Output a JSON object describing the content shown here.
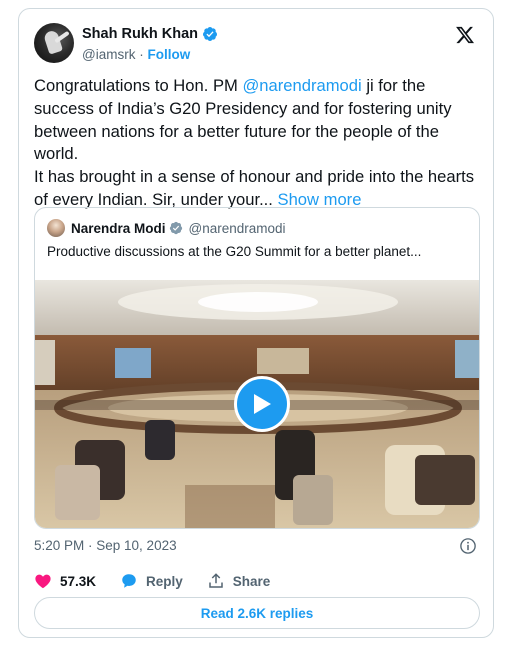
{
  "author": {
    "name": "Shah Rukh Khan",
    "handle": "@iamsrk",
    "separator": " · ",
    "follow_label": "Follow"
  },
  "tweet": {
    "text_part1": "Congratulations to Hon. PM ",
    "mention": "@narendramodi",
    "text_part2": " ji for the success of India’s G20 Presidency and for fostering unity between nations for a better future for the people of the world.",
    "text_line2": "It has brought in a sense of honour and pride into the hearts of every Indian. Sir, under your... ",
    "show_more": "Show more"
  },
  "quoted": {
    "name": "Narendra Modi",
    "handle": "@narendramodi",
    "text": "Productive discussions at the G20 Summit for a better planet..."
  },
  "meta": {
    "timestamp": "5:20 PM · Sep 10, 2023"
  },
  "actions": {
    "likes": "57.3K",
    "reply_label": "Reply",
    "share_label": "Share"
  },
  "read_replies": "Read 2.6K replies",
  "colors": {
    "accent": "#1d9bf0",
    "like": "#f91880",
    "text": "#0f1419",
    "muted": "#536471"
  }
}
